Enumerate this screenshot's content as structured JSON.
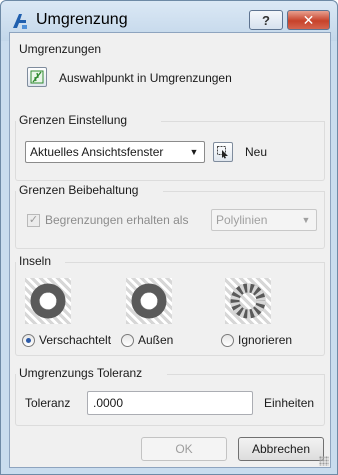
{
  "window": {
    "title": "Umgrenzung",
    "help_label": "?",
    "close_label": "✕",
    "app_icon": "hatch-boundary-app-icon"
  },
  "umgrenzungen": {
    "title": "Umgrenzungen",
    "pick_label": "Auswahlpunkt in Umgrenzungen",
    "pick_icon": "pick-point-icon"
  },
  "grenzen_einstellung": {
    "title": "Grenzen Einstellung",
    "selected": "Aktuelles Ansichtsfenster",
    "new_label": "Neu",
    "new_icon": "select-cursor-icon"
  },
  "grenzen_beibehaltung": {
    "title": "Grenzen Beibehaltung",
    "checkbox_label": "Begrenzungen erhalten als",
    "checked": true,
    "type_value": "Polylinien"
  },
  "inseln": {
    "title": "Inseln",
    "options": [
      {
        "label": "Verschachtelt",
        "checked": true
      },
      {
        "label": "Außen",
        "checked": false
      },
      {
        "label": "Ignorieren",
        "checked": false
      }
    ]
  },
  "toleranz": {
    "title": "Umgrenzungs Toleranz",
    "label": "Toleranz",
    "value": ".0000",
    "unit": "Einheiten"
  },
  "buttons": {
    "ok": "OK",
    "cancel": "Abbrechen"
  },
  "colors": {
    "title_bar": "#c9dcee",
    "close_button": "#c7422a",
    "island_ring": "#5a5a5a"
  }
}
